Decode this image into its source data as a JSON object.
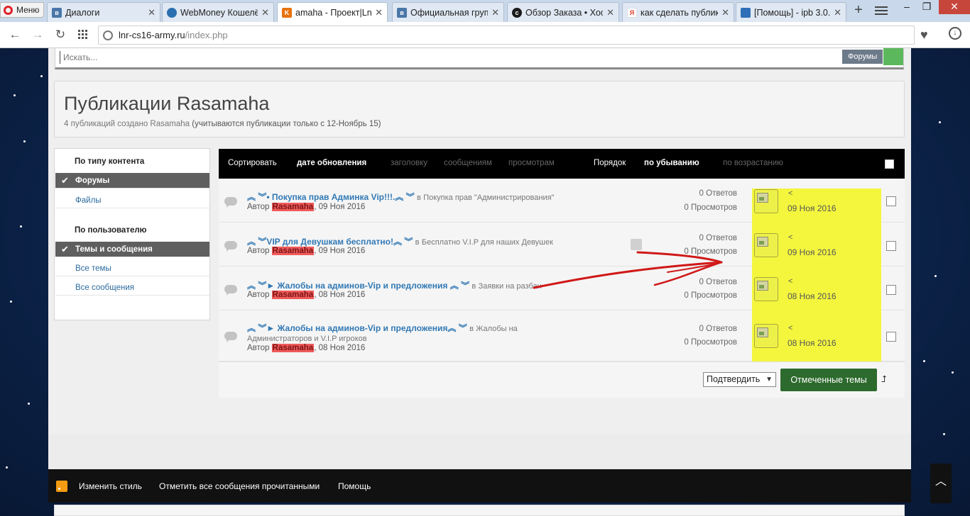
{
  "browser": {
    "menu_label": "Меню",
    "tabs": [
      {
        "title": "Диалоги",
        "favicon_color": "#4a76a8",
        "icon": "vk-icon"
      },
      {
        "title": "WebMoney Кошелё",
        "favicon_color": "#2a6fb0",
        "icon": "globe-icon"
      },
      {
        "title": "amaha - Проект|Lnr",
        "favicon_color": "#e8720c",
        "icon": "cs-icon"
      },
      {
        "title": "Официальная груп",
        "favicon_color": "#4a76a8",
        "icon": "vk-icon"
      },
      {
        "title": "Обзор Заказа • Хос",
        "favicon_color": "#1b1b1b",
        "icon": "cs-icon"
      },
      {
        "title": "как сделать публик",
        "favicon_color": "#e23a2b",
        "icon": "yandex-icon"
      },
      {
        "title": "[Помощь] - ipb 3.0.",
        "favicon_color": "#2f6fb7",
        "icon": "ipb-icon"
      }
    ],
    "url_host": "lnr-cs16-army.ru",
    "url_path": "/index.php"
  },
  "search": {
    "placeholder": "Искать...",
    "scope": "Форумы"
  },
  "header": {
    "title": "Публикации Rasamaha",
    "subtitle": "4 публикаций создано Rasamaha",
    "subtitle_note": "(учитываются публикации только с 12-Ноябрь 15)"
  },
  "sidebar": {
    "by_content": "По типу контента",
    "content_items": [
      "Форумы",
      "Файлы"
    ],
    "by_user": "По пользователю",
    "user_items": [
      "Темы и сообщения",
      "Все темы",
      "Все сообщения"
    ]
  },
  "sortbar": {
    "sort_label": "Сортировать",
    "sort_options": [
      "дате обновления",
      "заголовку",
      "сообщениям",
      "просмотрам"
    ],
    "order_label": "Порядок",
    "order_options": [
      "по убыванию",
      "по возрастанию"
    ]
  },
  "topics": [
    {
      "title": "︽ ︾• Покупка прав Админка Vip!!!.︽ ︾",
      "in_label": "в",
      "forum": "Покупка прав \"Администрирования\"",
      "author_prefix": "Автор",
      "author": "Rasamaha",
      "date": ", 09 Ноя 2016",
      "replies": "0 Ответов",
      "views": "0 Просмотров",
      "last_arrow": "<",
      "last_date": "09 Ноя 2016"
    },
    {
      "title": "︽ ︾VIP для Девушкам бесплатно!︽ ︾",
      "in_label": "в",
      "forum": "Бесплатно V.I.P для наших Девушек",
      "author_prefix": "Автор",
      "author": "Rasamaha",
      "date": ", 09 Ноя 2016",
      "replies": "0 Ответов",
      "views": "0 Просмотров",
      "last_arrow": "<",
      "last_date": "09 Ноя 2016"
    },
    {
      "title": "︽ ︾► Жалобы на админов-Vip и предложения ︽ ︾",
      "in_label": "в",
      "forum": "Заявки на разбан",
      "author_prefix": "Автор",
      "author": "Rasamaha",
      "date": ", 08 Ноя 2016",
      "replies": "0 Ответов",
      "views": "0 Просмотров",
      "last_arrow": "<",
      "last_date": "08 Ноя 2016"
    },
    {
      "title": "︽ ︾► Жалобы на админов-Vip и предложения︽ ︾",
      "in_label": "в",
      "forum": "Жалобы на",
      "forum_line2": "Администраторов и V.I.P игроков",
      "author_prefix": "Автор",
      "author": "Rasamaha",
      "date": ", 08 Ноя 2016",
      "replies": "0 Ответов",
      "views": "0 Просмотров",
      "last_arrow": "<",
      "last_date": "08 Ноя 2016"
    }
  ],
  "moderation": {
    "select_value": "Подтвердить",
    "button_label": "Отмеченные темы"
  },
  "footer": {
    "links": [
      "Изменить стиль",
      "Отметить все сообщения прочитанными",
      "Помощь"
    ]
  },
  "colors": {
    "highlight": "#f4f63e",
    "annotation_arrow": "#d01818",
    "author_highlight": "#f05a5a",
    "link": "#3179b5"
  }
}
